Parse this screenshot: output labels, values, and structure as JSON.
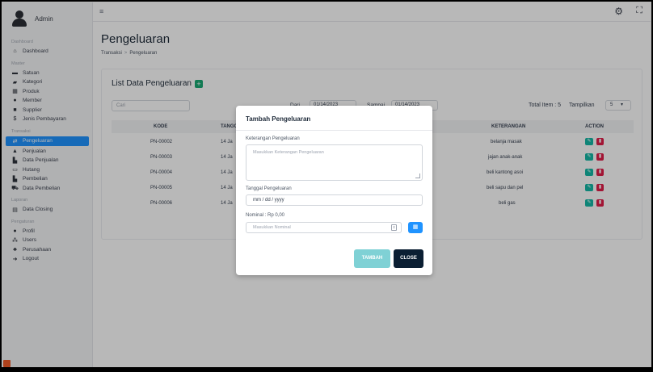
{
  "brand": {
    "name": "Admin"
  },
  "sidebar": {
    "sections": [
      {
        "title": "Dashboard",
        "items": [
          {
            "label": "Dashboard",
            "icon": "home-icon"
          }
        ]
      },
      {
        "title": "Master",
        "items": [
          {
            "label": "Satuan",
            "icon": "folder-icon"
          },
          {
            "label": "Kategori",
            "icon": "folder-open-icon"
          },
          {
            "label": "Produk",
            "icon": "cubes-icon"
          },
          {
            "label": "Member",
            "icon": "user-icon"
          },
          {
            "label": "Supplier",
            "icon": "truck-icon"
          },
          {
            "label": "Jenis Pembayaran",
            "icon": "dollar-icon"
          }
        ]
      },
      {
        "title": "Transaksi",
        "items": [
          {
            "label": "Pengeluaran",
            "icon": "exchange-icon",
            "active": true
          },
          {
            "label": "Penjualan",
            "icon": "flask-icon"
          },
          {
            "label": "Data Penjualan",
            "icon": "chart-icon"
          },
          {
            "label": "Hutang",
            "icon": "money-icon"
          },
          {
            "label": "Pembelian",
            "icon": "chart-icon"
          },
          {
            "label": "Data Pembelian",
            "icon": "cart-icon"
          }
        ]
      },
      {
        "title": "Laporan",
        "items": [
          {
            "label": "Data Closing",
            "icon": "file-icon"
          }
        ]
      },
      {
        "title": "Pengaturan",
        "items": [
          {
            "label": "Profil",
            "icon": "user-cog-icon"
          },
          {
            "label": "Users",
            "icon": "users-icon"
          },
          {
            "label": "Perusahaan",
            "icon": "building-icon"
          },
          {
            "label": "Logout",
            "icon": "logout-icon"
          }
        ]
      }
    ]
  },
  "topbar": {
    "menu_glyph": "≡",
    "settings_glyph": "⚙",
    "expand_glyph": "⛶"
  },
  "page": {
    "title": "Pengeluaran",
    "breadcrumb": [
      "Transaksi",
      "Pengeluaran"
    ],
    "breadcrumb_sep": ">"
  },
  "list": {
    "title": "List Data Pengeluaran",
    "add_glyph": "+",
    "search_placeholder": "Cari",
    "filter_from_label": "Dari",
    "filter_from_value": "01/14/2023",
    "filter_to_label": "Sampai",
    "filter_to_value": "01/14/2023",
    "total_label": "Total Item : 5",
    "show_label": "Tampilkan",
    "show_value": "5",
    "columns": [
      "KODE",
      "TANGGAL",
      "KETERANGAN",
      "ACTION"
    ],
    "rows": [
      {
        "kode": "PN-00002",
        "tanggal": "14 Ja",
        "keterangan": "belanja masak"
      },
      {
        "kode": "PN-00003",
        "tanggal": "14 Ja",
        "keterangan": "jajan anak-anak"
      },
      {
        "kode": "PN-00004",
        "tanggal": "14 Ja",
        "keterangan": "beli kantong asoi"
      },
      {
        "kode": "PN-00005",
        "tanggal": "14 Ja",
        "keterangan": "beli sapu dan pel"
      },
      {
        "kode": "PN-00006",
        "tanggal": "14 Ja",
        "keterangan": "beli gas"
      }
    ]
  },
  "modal": {
    "title": "Tambah Pengeluaran",
    "keterangan_label": "Keterangan Pengeluaran",
    "keterangan_placeholder": "Masukkan Keterangan Pengeluaran",
    "tanggal_label": "Tanggal Pengeluaran",
    "tanggal_value": "mm / dd / yyyy",
    "nominal_label": "Nominal : Rp 0,00",
    "nominal_placeholder": "Masukkan Nominal",
    "submit_label": "TAMBAH",
    "close_label": "CLOSE"
  }
}
